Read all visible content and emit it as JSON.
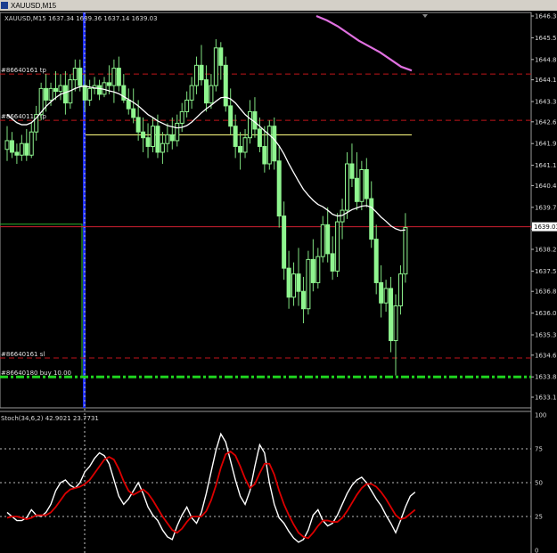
{
  "window": {
    "title": "XAUUSD,M15",
    "colors": {
      "background": "#000000",
      "frame": "#cfcfcf",
      "titlebar": "#d4d0c8"
    }
  },
  "chart_data": [
    {
      "type": "candlestick",
      "symbol": "XAUUSD",
      "timeframe": "M15",
      "ohlc_label": "1637.34 1639.36 1637.14 1639.03",
      "ylim": [
        1633.15,
        1646.3
      ],
      "y_ticks": [
        "1646.30",
        "1645.55",
        "1644.80",
        "1644.10",
        "1643.35",
        "1642.65",
        "1641.90",
        "1641.15",
        "1640.45",
        "1639.70",
        "1638.95",
        "1638.25",
        "1637.50",
        "1636.80",
        "1636.05",
        "1635.30",
        "1634.60",
        "1633.85",
        "1633.15"
      ],
      "current_price": "1639.03",
      "grid": false,
      "order_lines": [
        {
          "label": "#86640161 tp",
          "price": 1644.3,
          "style": "dash",
          "color": "#c0151b"
        },
        {
          "label": "#86640114 tp",
          "price": 1642.7,
          "style": "dash",
          "color": "#c0151b"
        },
        {
          "label": "#86640161 sl",
          "price": 1634.5,
          "style": "dash",
          "color": "#c0151b"
        },
        {
          "label": "#86640180 buy 10.00",
          "price": 1633.85,
          "style": "dashdot",
          "color": "#1fd41f"
        }
      ],
      "objects": [
        {
          "kind": "horizontal-segment",
          "price": 1642.2,
          "color": "#f2f07a"
        },
        {
          "kind": "vertical-line",
          "color": "#2030ff"
        },
        {
          "kind": "bid-line",
          "price": 1639.03,
          "color": "#d02030"
        }
      ],
      "candles": [
        [
          1641.7,
          1642.5,
          1641.3,
          1642.0
        ],
        [
          1642.0,
          1642.3,
          1641.4,
          1641.6
        ],
        [
          1641.6,
          1641.9,
          1641.2,
          1641.5
        ],
        [
          1641.5,
          1642.2,
          1641.3,
          1641.9
        ],
        [
          1641.9,
          1642.4,
          1641.3,
          1641.5
        ],
        [
          1641.5,
          1642.6,
          1641.4,
          1642.3
        ],
        [
          1642.3,
          1643.2,
          1642.0,
          1642.9
        ],
        [
          1642.9,
          1644.0,
          1642.7,
          1643.8
        ],
        [
          1643.8,
          1644.3,
          1643.0,
          1643.4
        ],
        [
          1643.4,
          1644.0,
          1643.2,
          1643.8
        ],
        [
          1643.8,
          1644.4,
          1643.4,
          1643.7
        ],
        [
          1643.7,
          1644.3,
          1643.4,
          1643.9
        ],
        [
          1643.9,
          1644.4,
          1642.9,
          1643.3
        ],
        [
          1643.3,
          1644.3,
          1643.1,
          1644.1
        ],
        [
          1644.1,
          1644.8,
          1643.7,
          1644.5
        ],
        [
          1644.5,
          1644.8,
          1643.7,
          1643.9
        ],
        [
          1643.9,
          1644.3,
          1643.0,
          1643.4
        ],
        [
          1643.4,
          1644.1,
          1643.2,
          1643.8
        ],
        [
          1643.8,
          1644.2,
          1643.6,
          1643.9
        ],
        [
          1643.9,
          1644.1,
          1643.4,
          1643.6
        ],
        [
          1643.6,
          1644.2,
          1643.5,
          1644.0
        ],
        [
          1644.0,
          1644.6,
          1643.6,
          1643.9
        ],
        [
          1643.9,
          1644.8,
          1643.3,
          1644.5
        ],
        [
          1644.5,
          1644.9,
          1643.7,
          1643.9
        ],
        [
          1643.9,
          1644.3,
          1643.3,
          1643.4
        ],
        [
          1643.4,
          1643.8,
          1642.9,
          1643.1
        ],
        [
          1643.1,
          1643.8,
          1642.6,
          1642.8
        ],
        [
          1642.8,
          1643.4,
          1642.0,
          1642.3
        ],
        [
          1642.3,
          1642.8,
          1641.6,
          1642.1
        ],
        [
          1642.1,
          1642.6,
          1641.4,
          1641.8
        ],
        [
          1641.8,
          1642.8,
          1641.6,
          1642.5
        ],
        [
          1642.5,
          1642.9,
          1641.4,
          1641.6
        ],
        [
          1641.6,
          1642.3,
          1641.2,
          1641.9
        ],
        [
          1641.9,
          1642.6,
          1641.6,
          1642.2
        ],
        [
          1642.2,
          1642.8,
          1641.7,
          1642.0
        ],
        [
          1642.0,
          1642.9,
          1641.8,
          1642.6
        ],
        [
          1642.6,
          1643.3,
          1642.3,
          1643.0
        ],
        [
          1643.0,
          1643.7,
          1642.8,
          1643.4
        ],
        [
          1643.4,
          1644.2,
          1643.1,
          1643.9
        ],
        [
          1643.9,
          1644.9,
          1643.6,
          1644.6
        ],
        [
          1644.6,
          1645.3,
          1643.9,
          1644.1
        ],
        [
          1644.1,
          1644.6,
          1643.0,
          1643.3
        ],
        [
          1643.3,
          1644.3,
          1643.1,
          1643.9
        ],
        [
          1643.9,
          1645.5,
          1643.7,
          1645.2
        ],
        [
          1645.2,
          1645.4,
          1644.1,
          1644.6
        ],
        [
          1644.6,
          1644.9,
          1643.0,
          1643.2
        ],
        [
          1643.2,
          1643.8,
          1642.2,
          1642.5
        ],
        [
          1642.5,
          1642.9,
          1641.4,
          1641.8
        ],
        [
          1641.8,
          1642.3,
          1641.0,
          1641.6
        ],
        [
          1641.6,
          1642.4,
          1641.4,
          1642.1
        ],
        [
          1642.1,
          1643.4,
          1641.9,
          1643.0
        ],
        [
          1643.0,
          1643.5,
          1642.1,
          1642.4
        ],
        [
          1642.4,
          1642.8,
          1641.6,
          1641.8
        ],
        [
          1641.8,
          1642.5,
          1640.9,
          1641.2
        ],
        [
          1641.2,
          1642.7,
          1641.0,
          1642.5
        ],
        [
          1642.5,
          1642.8,
          1641.0,
          1641.3
        ],
        [
          1641.3,
          1641.8,
          1639.0,
          1639.4
        ],
        [
          1639.4,
          1639.9,
          1637.2,
          1637.6
        ],
        [
          1637.6,
          1638.2,
          1636.2,
          1636.6
        ],
        [
          1636.6,
          1637.8,
          1636.3,
          1637.4
        ],
        [
          1637.4,
          1638.3,
          1636.3,
          1636.8
        ],
        [
          1636.8,
          1637.3,
          1635.7,
          1636.2
        ],
        [
          1636.2,
          1638.2,
          1636.0,
          1637.9
        ],
        [
          1637.9,
          1638.6,
          1636.8,
          1637.1
        ],
        [
          1637.1,
          1638.3,
          1636.9,
          1638.0
        ],
        [
          1638.0,
          1639.4,
          1637.8,
          1639.1
        ],
        [
          1639.1,
          1639.7,
          1637.8,
          1638.1
        ],
        [
          1638.1,
          1638.7,
          1637.2,
          1637.5
        ],
        [
          1637.5,
          1639.5,
          1637.3,
          1639.2
        ],
        [
          1639.2,
          1640.0,
          1638.6,
          1639.6
        ],
        [
          1639.6,
          1641.6,
          1639.3,
          1641.2
        ],
        [
          1641.2,
          1641.9,
          1640.4,
          1640.7
        ],
        [
          1640.7,
          1641.6,
          1639.6,
          1639.9
        ],
        [
          1639.9,
          1641.3,
          1639.6,
          1641.0
        ],
        [
          1641.0,
          1641.4,
          1639.7,
          1640.0
        ],
        [
          1640.0,
          1640.6,
          1638.3,
          1638.6
        ],
        [
          1638.6,
          1639.1,
          1636.7,
          1637.1
        ],
        [
          1637.1,
          1637.7,
          1635.9,
          1636.4
        ],
        [
          1636.4,
          1637.2,
          1636.1,
          1636.9
        ],
        [
          1636.9,
          1637.3,
          1634.7,
          1635.1
        ],
        [
          1635.1,
          1636.7,
          1633.9,
          1636.3
        ],
        [
          1636.3,
          1637.7,
          1636.0,
          1637.4
        ],
        [
          1637.4,
          1639.5,
          1637.1,
          1639.0
        ]
      ],
      "ma_label": "",
      "ma_values": [
        1642.9,
        1642.75,
        1642.62,
        1642.55,
        1642.55,
        1642.62,
        1642.78,
        1642.98,
        1643.18,
        1643.34,
        1643.48,
        1643.6,
        1643.66,
        1643.72,
        1643.8,
        1643.86,
        1643.88,
        1643.85,
        1643.82,
        1643.8,
        1643.77,
        1643.72,
        1643.68,
        1643.62,
        1643.52,
        1643.42,
        1643.32,
        1643.2,
        1643.05,
        1642.9,
        1642.8,
        1642.68,
        1642.6,
        1642.52,
        1642.48,
        1642.44,
        1642.46,
        1642.52,
        1642.64,
        1642.8,
        1642.96,
        1643.1,
        1643.22,
        1643.36,
        1643.48,
        1643.5,
        1643.44,
        1643.3,
        1643.1,
        1642.9,
        1642.76,
        1642.64,
        1642.5,
        1642.34,
        1642.2,
        1642.04,
        1641.82,
        1641.54,
        1641.2,
        1640.9,
        1640.6,
        1640.32,
        1640.12,
        1639.94,
        1639.8,
        1639.72,
        1639.6,
        1639.46,
        1639.4,
        1639.42,
        1639.52,
        1639.62,
        1639.68,
        1639.74,
        1639.76,
        1639.7,
        1639.54,
        1639.36,
        1639.22,
        1639.06,
        1638.96,
        1638.9,
        1638.92
      ],
      "upper_curve": [
        1646.3,
        1646.15,
        1645.95,
        1645.7,
        1645.45,
        1645.25,
        1645.05,
        1644.8,
        1644.55,
        1644.42
      ]
    },
    {
      "type": "line",
      "title": "Stoch(34,6,2) 42.9021 23.7731",
      "ylim": [
        0,
        100
      ],
      "y_ticks": [
        "100",
        "75",
        "50",
        "25",
        "0"
      ],
      "levels": [
        75,
        50,
        25
      ],
      "series": [
        {
          "color": "#ffffff",
          "values": [
            28,
            25,
            22,
            22,
            24,
            30,
            26,
            25,
            28,
            34,
            44,
            50,
            52,
            48,
            46,
            50,
            58,
            62,
            68,
            72,
            70,
            64,
            52,
            40,
            34,
            38,
            44,
            50,
            42,
            32,
            26,
            22,
            15,
            10,
            8,
            18,
            26,
            32,
            24,
            20,
            28,
            42,
            58,
            74,
            86,
            80,
            66,
            52,
            40,
            34,
            44,
            62,
            78,
            72,
            50,
            34,
            24,
            20,
            14,
            9,
            6,
            8,
            15,
            26,
            30,
            22,
            18,
            20,
            26,
            34,
            42,
            48,
            52,
            54,
            50,
            44,
            38,
            33,
            26,
            20,
            13,
            22,
            32,
            40,
            43
          ]
        },
        {
          "color": "#dc0000",
          "values": [
            24,
            25,
            25,
            24,
            23,
            24,
            26,
            26,
            26,
            28,
            32,
            37,
            42,
            45,
            46,
            47,
            49,
            52,
            57,
            62,
            67,
            69,
            67,
            60,
            51,
            44,
            41,
            43,
            45,
            42,
            37,
            31,
            25,
            20,
            15,
            13,
            16,
            21,
            25,
            25,
            25,
            29,
            37,
            48,
            61,
            71,
            73,
            70,
            62,
            53,
            46,
            49,
            57,
            64,
            64,
            56,
            44,
            34,
            26,
            19,
            13,
            10,
            9,
            13,
            18,
            22,
            22,
            21,
            21,
            24,
            29,
            35,
            41,
            46,
            49,
            49,
            47,
            43,
            38,
            32,
            26,
            23,
            24,
            27,
            30
          ]
        }
      ]
    }
  ]
}
